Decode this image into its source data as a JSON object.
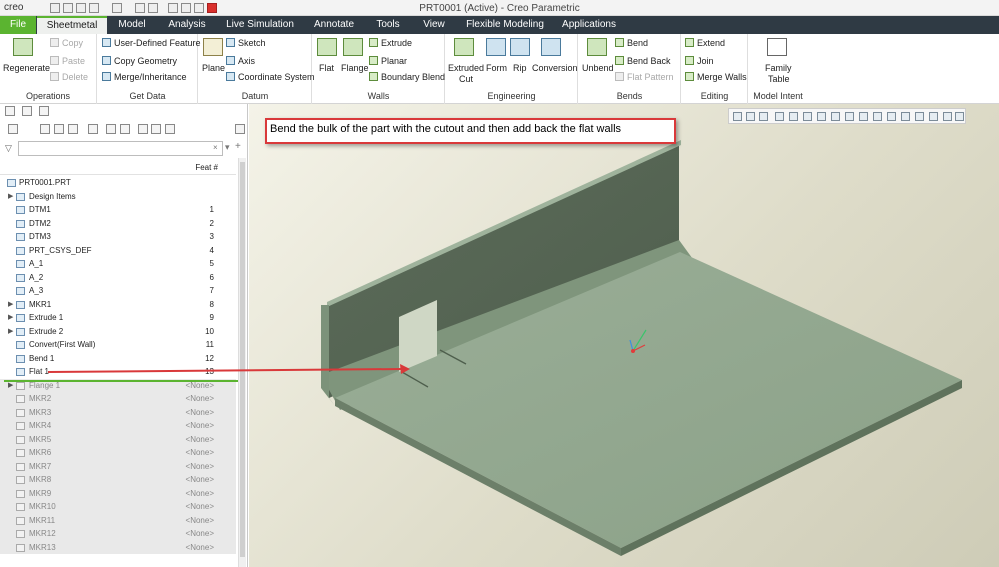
{
  "titlebar": {
    "logo": "creo",
    "title": "PRT0001 (Active) - Creo Parametric"
  },
  "menu": {
    "tabs": [
      "File",
      "Sheetmetal",
      "Model",
      "Analysis",
      "Live Simulation",
      "Annotate",
      "Tools",
      "View",
      "Flexible Modeling",
      "Applications"
    ]
  },
  "ribbon": {
    "operations": {
      "regenerate": "Regenerate",
      "copy": "Copy",
      "paste": "Paste",
      "delete": "Delete",
      "label": "Operations"
    },
    "getdata": {
      "udf": "User-Defined Feature",
      "copygeom": "Copy Geometry",
      "merge": "Merge/Inheritance",
      "label": "Get Data"
    },
    "datum": {
      "plane": "Plane",
      "sketch": "Sketch",
      "axis": "Axis",
      "csys": "Coordinate System",
      "label": "Datum"
    },
    "walls": {
      "flat": "Flat",
      "flange": "Flange",
      "extrude": "Extrude",
      "planar": "Planar",
      "boundary": "Boundary Blend",
      "label": "Walls"
    },
    "engineering": {
      "cut1": "Extruded",
      "cut2": "Cut",
      "form": "Form",
      "rip": "Rip",
      "conversion": "Conversion",
      "label": "Engineering"
    },
    "bends": {
      "unbend": "Unbend",
      "bend": "Bend",
      "bendback": "Bend Back",
      "flatpattern": "Flat Pattern",
      "label": "Bends"
    },
    "editing": {
      "extend": "Extend",
      "join": "Join",
      "mergewalls": "Merge Walls",
      "label": "Editing"
    },
    "intent": {
      "ft1": "Family",
      "ft2": "Table",
      "label": "Model Intent"
    }
  },
  "tree": {
    "col_header": "Feat #",
    "items": [
      {
        "label": "PRT0001.PRT",
        "num": "",
        "exp": ""
      },
      {
        "label": "Design Items",
        "num": "",
        "exp": "▶"
      },
      {
        "label": "DTM1",
        "num": "1",
        "exp": ""
      },
      {
        "label": "DTM2",
        "num": "2",
        "exp": ""
      },
      {
        "label": "DTM3",
        "num": "3",
        "exp": ""
      },
      {
        "label": "PRT_CSYS_DEF",
        "num": "4",
        "exp": ""
      },
      {
        "label": "A_1",
        "num": "5",
        "exp": ""
      },
      {
        "label": "A_2",
        "num": "6",
        "exp": ""
      },
      {
        "label": "A_3",
        "num": "7",
        "exp": ""
      },
      {
        "label": "MKR1",
        "num": "8",
        "exp": "▶"
      },
      {
        "label": "Extrude 1",
        "num": "9",
        "exp": "▶"
      },
      {
        "label": "Extrude 2",
        "num": "10",
        "exp": "▶"
      },
      {
        "label": "Convert(First Wall)",
        "num": "11",
        "exp": ""
      },
      {
        "label": "Bend 1",
        "num": "12",
        "exp": ""
      },
      {
        "label": "Flat 1",
        "num": "13",
        "exp": ""
      },
      {
        "label": "Flange 1",
        "num": "<None>",
        "exp": "▶"
      },
      {
        "label": "MKR2",
        "num": "<None>",
        "exp": ""
      },
      {
        "label": "MKR3",
        "num": "<None>",
        "exp": ""
      },
      {
        "label": "MKR4",
        "num": "<None>",
        "exp": ""
      },
      {
        "label": "MKR5",
        "num": "<None>",
        "exp": ""
      },
      {
        "label": "MKR6",
        "num": "<None>",
        "exp": ""
      },
      {
        "label": "MKR7",
        "num": "<None>",
        "exp": ""
      },
      {
        "label": "MKR8",
        "num": "<None>",
        "exp": ""
      },
      {
        "label": "MKR9",
        "num": "<None>",
        "exp": ""
      },
      {
        "label": "MKR10",
        "num": "<None>",
        "exp": ""
      },
      {
        "label": "MKR11",
        "num": "<None>",
        "exp": ""
      },
      {
        "label": "MKR12",
        "num": "<None>",
        "exp": ""
      },
      {
        "label": "MKR13",
        "num": "<None>",
        "exp": ""
      }
    ]
  },
  "annotation": "Bend the bulk of the part with the cutout and then add back the flat walls",
  "colors": {
    "accent": "#5bb430",
    "menubar": "#2f3a44",
    "part": "#8fa48c",
    "arrow": "#d9393a"
  }
}
